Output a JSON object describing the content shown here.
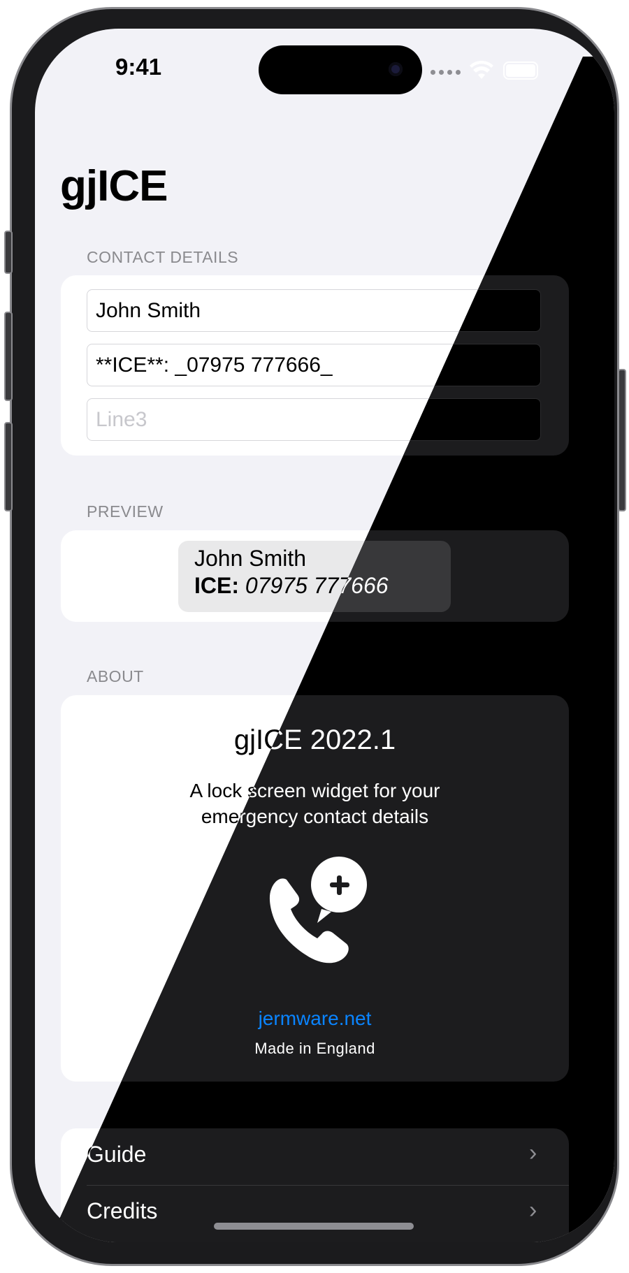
{
  "status_bar": {
    "time": "9:41"
  },
  "nav": {
    "title": "gjICE"
  },
  "contact": {
    "header": "CONTACT DETAILS",
    "line1_value": "John Smith",
    "line2_value": "**ICE**: _07975 777666_",
    "line3_value": "",
    "line3_placeholder": "Line3"
  },
  "preview": {
    "header": "PREVIEW",
    "name": "John Smith",
    "ice_label": "ICE:",
    "ice_number": "07975 777666"
  },
  "about": {
    "header": "ABOUT",
    "title": "gjICE 2022.1",
    "description_line1": "A lock screen widget for your",
    "description_line2": "emergency contact details",
    "app_icon": "phone-plus-icon",
    "link": "jermware.net",
    "footer": "Made in England"
  },
  "menu": {
    "items": [
      {
        "label": "Guide"
      },
      {
        "label": "Credits"
      }
    ]
  },
  "colors": {
    "link": "#0a84ff",
    "light_bg": "#f2f2f7",
    "dark_bg": "#000000"
  }
}
